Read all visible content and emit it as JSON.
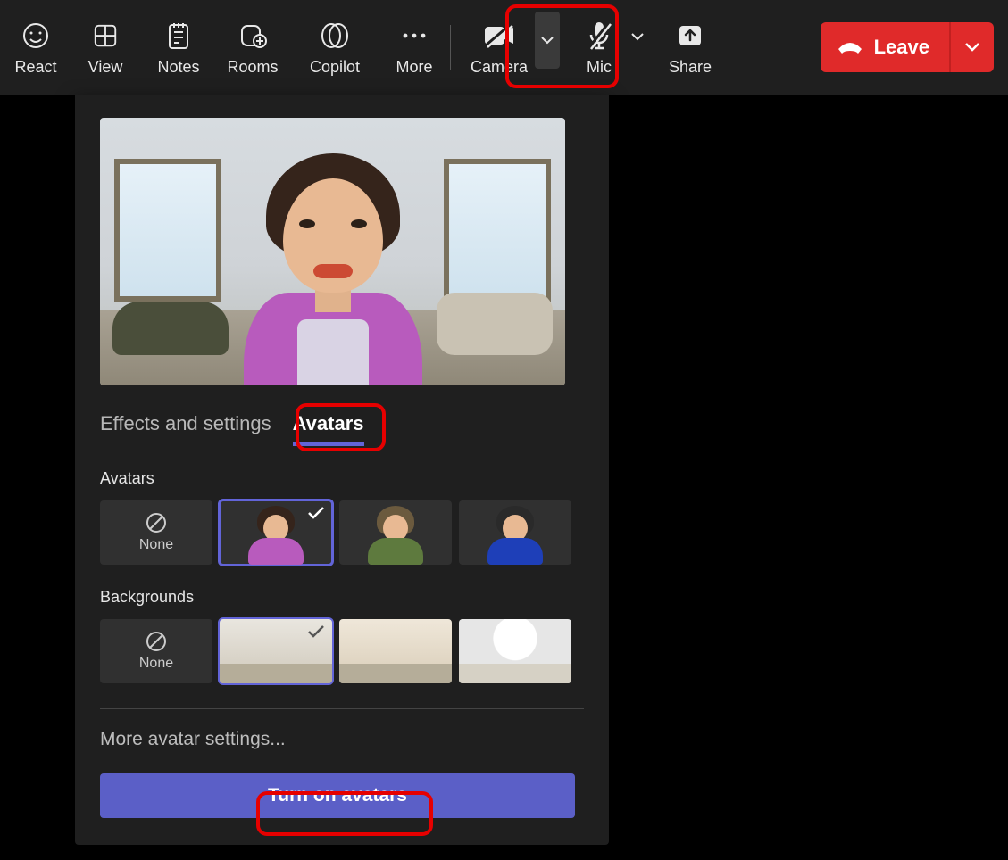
{
  "toolbar": {
    "react": "React",
    "view": "View",
    "notes": "Notes",
    "rooms": "Rooms",
    "copilot": "Copilot",
    "more": "More",
    "camera": "Camera",
    "mic": "Mic",
    "share": "Share",
    "leave": "Leave"
  },
  "panel": {
    "tabs": {
      "effects": "Effects and settings",
      "avatars": "Avatars"
    },
    "avatars_label": "Avatars",
    "none_label": "None",
    "backgrounds_label": "Backgrounds",
    "more_settings": "More avatar settings...",
    "turn_on": "Turn on avatars"
  }
}
